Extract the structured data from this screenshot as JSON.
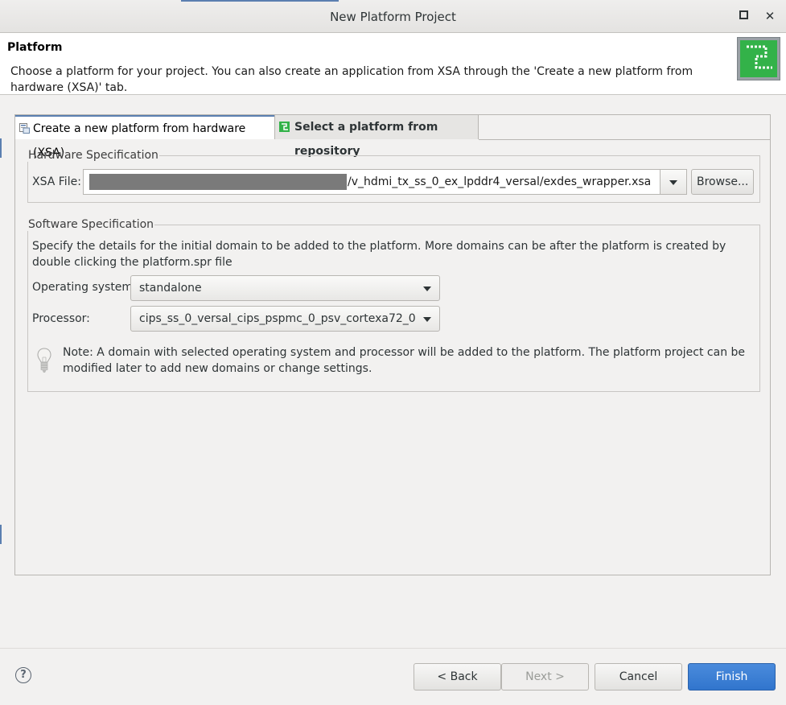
{
  "window": {
    "title": "New Platform Project"
  },
  "header": {
    "title": "Platform",
    "description": "Choose a platform for your project. You can also create an application from XSA through the 'Create a new platform from hardware (XSA)' tab."
  },
  "tabs": [
    {
      "label": "Create a new platform from hardware (XSA)",
      "active": true
    },
    {
      "label": "Select a platform from repository",
      "active": false
    }
  ],
  "hardware": {
    "legend": "Hardware Specification",
    "xsa_label": "XSA File:",
    "xsa_value": "/v_hdmi_tx_ss_0_ex_lpddr4_versal/exdes_wrapper.xsa",
    "browse_label": "Browse..."
  },
  "software": {
    "legend": "Software Specification",
    "description": "Specify the details for the initial domain to be added to the platform. More domains can be after the platform is created by double clicking the platform.spr file",
    "os_label": "Operating system:",
    "os_value": "standalone",
    "processor_label": "Processor:",
    "processor_value": "cips_ss_0_versal_cips_pspmc_0_psv_cortexa72_0",
    "note": "Note: A domain with selected operating system and processor will be added to the platform. The platform project can be modified later to add new domains or change settings."
  },
  "footer": {
    "help_label": "?",
    "back_label": "< Back",
    "next_label": "Next >",
    "cancel_label": "Cancel",
    "finish_label": "Finish"
  },
  "colors": {
    "accent": "#3175cd",
    "logo_green": "#33b249"
  },
  "icons": [
    "maximize-icon",
    "close-icon",
    "platform-logo-icon",
    "hardware-tab-icon",
    "repository-tab-icon",
    "dropdown-arrow-icon",
    "lightbulb-icon",
    "help-icon"
  ]
}
